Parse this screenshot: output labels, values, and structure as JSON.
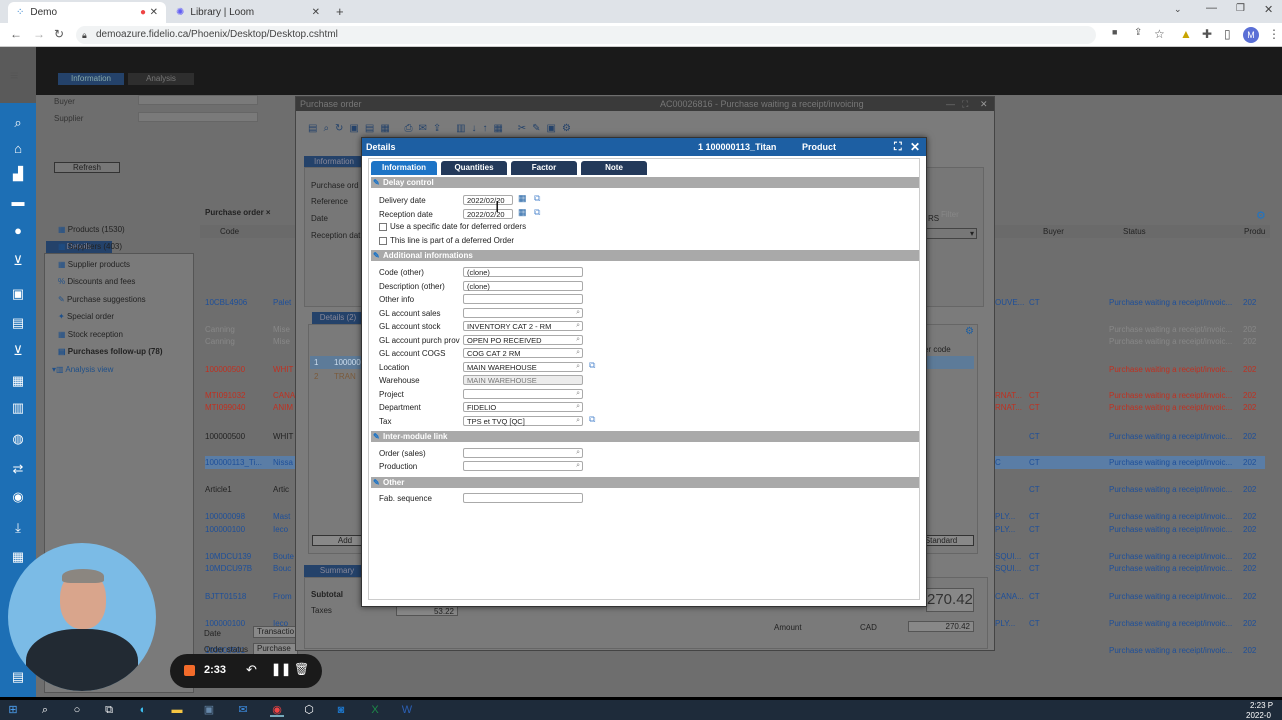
{
  "browser": {
    "tabs": [
      {
        "label": "Demo",
        "active": true
      },
      {
        "label": "Library | Loom",
        "active": false
      }
    ],
    "url": "demoazure.fidelio.ca/Phoenix/Desktop/Desktop.cshtml",
    "profile_initial": "M"
  },
  "app": {
    "tabs": [
      "Information",
      "Analysis"
    ],
    "filters": {
      "buyer": "Buyer",
      "supplier": "Supplier"
    },
    "refresh_label": "Refresh",
    "details_tab": "Details",
    "nav_items": [
      "Products (1530)",
      "Suppliers (403)",
      "Supplier products",
      "Discounts and fees",
      "Purchase suggestions",
      "Special order",
      "Stock reception",
      "Purchases follow-up (78)",
      "Analysis view"
    ],
    "grid_tab": "Purchase order ×",
    "grid_headers": {
      "code": "Code",
      "buyer": "Buyer",
      "status": "Status",
      "product": "Produ"
    },
    "rows": [
      {
        "code": "10CBL4906",
        "desc": "Palet",
        "mid": "OUVE...",
        "buyer": "CT",
        "status": "Purchase waiting a receipt/invoic...",
        "prod": "202",
        "color": "blue"
      },
      {
        "code": "Canning",
        "desc": "Mise",
        "mid": "",
        "buyer": "",
        "status": "Purchase waiting a receipt/invoic...",
        "prod": "202",
        "color": "grey"
      },
      {
        "code": "Canning",
        "desc": "Mise",
        "mid": "",
        "buyer": "",
        "status": "Purchase waiting a receipt/invoic...",
        "prod": "202",
        "color": "grey"
      },
      {
        "code": "100000500",
        "desc": "WHIT",
        "mid": "",
        "buyer": "",
        "status": "Purchase waiting a receipt/invoic...",
        "prod": "202",
        "color": "red"
      },
      {
        "code": "MTI091032",
        "desc": "CANA",
        "mid": "RNAT...",
        "buyer": "CT",
        "status": "Purchase waiting a receipt/invoic...",
        "prod": "202",
        "color": "red"
      },
      {
        "code": "MTI099040",
        "desc": "ANIM",
        "mid": "RNAT...",
        "buyer": "CT",
        "status": "Purchase waiting a receipt/invoic...",
        "prod": "202",
        "color": "red"
      },
      {
        "code": "100000500",
        "desc": "WHIT",
        "mid": "",
        "buyer": "CT",
        "status": "Purchase waiting a receipt/invoic...",
        "prod": "202",
        "color": "dark"
      },
      {
        "code": "100000113_Ti...",
        "desc": "Nissa",
        "mid": "C",
        "buyer": "CT",
        "status": "Purchase waiting a receipt/invoic...",
        "prod": "202",
        "color": "sel"
      },
      {
        "code": "Article1",
        "desc": "Artic",
        "mid": "",
        "buyer": "CT",
        "status": "Purchase waiting a receipt/invoic...",
        "prod": "202",
        "color": "dark"
      },
      {
        "code": "100000098",
        "desc": "Mast",
        "mid": "PLY...",
        "buyer": "CT",
        "status": "Purchase waiting a receipt/invoic...",
        "prod": "202",
        "color": "blue"
      },
      {
        "code": "100000100",
        "desc": "Ieco",
        "mid": "PLY...",
        "buyer": "CT",
        "status": "Purchase waiting a receipt/invoic...",
        "prod": "202",
        "color": "blue"
      },
      {
        "code": "10MDCU139",
        "desc": "Boute",
        "mid": "SQUI...",
        "buyer": "CT",
        "status": "Purchase waiting a receipt/invoic...",
        "prod": "202",
        "color": "blue"
      },
      {
        "code": "10MDCU97B",
        "desc": "Bouc",
        "mid": "SQUI...",
        "buyer": "CT",
        "status": "Purchase waiting a receipt/invoic...",
        "prod": "202",
        "color": "blue"
      },
      {
        "code": "BJTT01518",
        "desc": "From",
        "mid": "CANA...",
        "buyer": "CT",
        "status": "Purchase waiting a receipt/invoic...",
        "prod": "202",
        "color": "blue"
      },
      {
        "code": "100000100",
        "desc": "Ieco",
        "mid": "PLY...",
        "buyer": "CT",
        "status": "Purchase waiting a receipt/invoic...",
        "prod": "202",
        "color": "blue"
      },
      {
        "code": "100000501",
        "desc": "COLL",
        "mid": "",
        "buyer": "",
        "status": "Purchase waiting a receipt/invoic...",
        "prod": "202",
        "color": "blue"
      }
    ],
    "bottom": {
      "date_label": "Date",
      "date_value": "Transactio",
      "order_status_label": "Order status",
      "order_status_value": "Purchase"
    }
  },
  "purchase_order": {
    "title": "Purchase order",
    "right_title": "AC00026816 - Purchase waiting a receipt/invoicing",
    "info_tab": "Information",
    "labels": [
      "Purchase ord",
      "Reference",
      "Date",
      "Reception dat"
    ],
    "details_tab": "Details (2)",
    "detail_rows": [
      {
        "num": "1",
        "code": "100000"
      },
      {
        "num": "2",
        "code": "TRAN"
      }
    ],
    "add_label": "Add",
    "standard_label": "Standard",
    "filter_label": "Filter",
    "rs_label": "RS",
    "order_code_label": "er code",
    "summary_tab": "Summary",
    "subtotal_label": "Subtotal",
    "taxes_label": "Taxes",
    "taxes_value": "53.22",
    "big_amount": "270.42",
    "amount_label": "Amount",
    "currency": "CAD",
    "amount_value": "270.42"
  },
  "details": {
    "title": "Details",
    "line_info": "1  100000113_Titan",
    "type": "Product",
    "tabs": [
      "Information",
      "Quantities",
      "Factor",
      "Note"
    ],
    "sections": {
      "delay": "Delay control",
      "additional": "Additional informations",
      "intermodule": "Inter-module link",
      "other": "Other"
    },
    "delivery_date_label": "Delivery date",
    "delivery_date_value": "2022/02/20",
    "reception_date_label": "Reception date",
    "reception_date_value": "2022/02/20",
    "use_specific_date": "Use a specific date for deferred orders",
    "deferred_line": "This line is part of a deferred Order",
    "fields": [
      {
        "label": "Code (other)",
        "value": "(clone)",
        "search": false,
        "ro": false
      },
      {
        "label": "Description (other)",
        "value": "(clone)",
        "search": false,
        "ro": false
      },
      {
        "label": "Other info",
        "value": "",
        "search": false,
        "ro": false
      },
      {
        "label": "GL account sales",
        "value": "",
        "search": true,
        "ro": false
      },
      {
        "label": "GL account stock",
        "value": "INVENTORY CAT 2 - RM",
        "search": true,
        "ro": false
      },
      {
        "label": "GL account purch prov",
        "value": "OPEN PO RECEIVED",
        "search": true,
        "ro": false
      },
      {
        "label": "GL account COGS",
        "value": "COG CAT 2 RM",
        "search": true,
        "ro": false
      },
      {
        "label": "Location",
        "value": "MAIN WAREHOUSE",
        "search": true,
        "ro": false
      },
      {
        "label": "Warehouse",
        "value": "MAIN WAREHOUSE",
        "search": false,
        "ro": true
      },
      {
        "label": "Project",
        "value": "",
        "search": true,
        "ro": false
      },
      {
        "label": "Department",
        "value": "FIDELIO",
        "search": true,
        "ro": false
      },
      {
        "label": "Tax",
        "value": "TPS et TVQ [QC]",
        "search": true,
        "ro": false
      }
    ],
    "order_sales_label": "Order (sales)",
    "production_label": "Production",
    "fab_sequence_label": "Fab. sequence"
  },
  "recorder": {
    "time": "2:33"
  },
  "taskbar": {
    "clock": "2:23 P",
    "date": "2022-0"
  }
}
